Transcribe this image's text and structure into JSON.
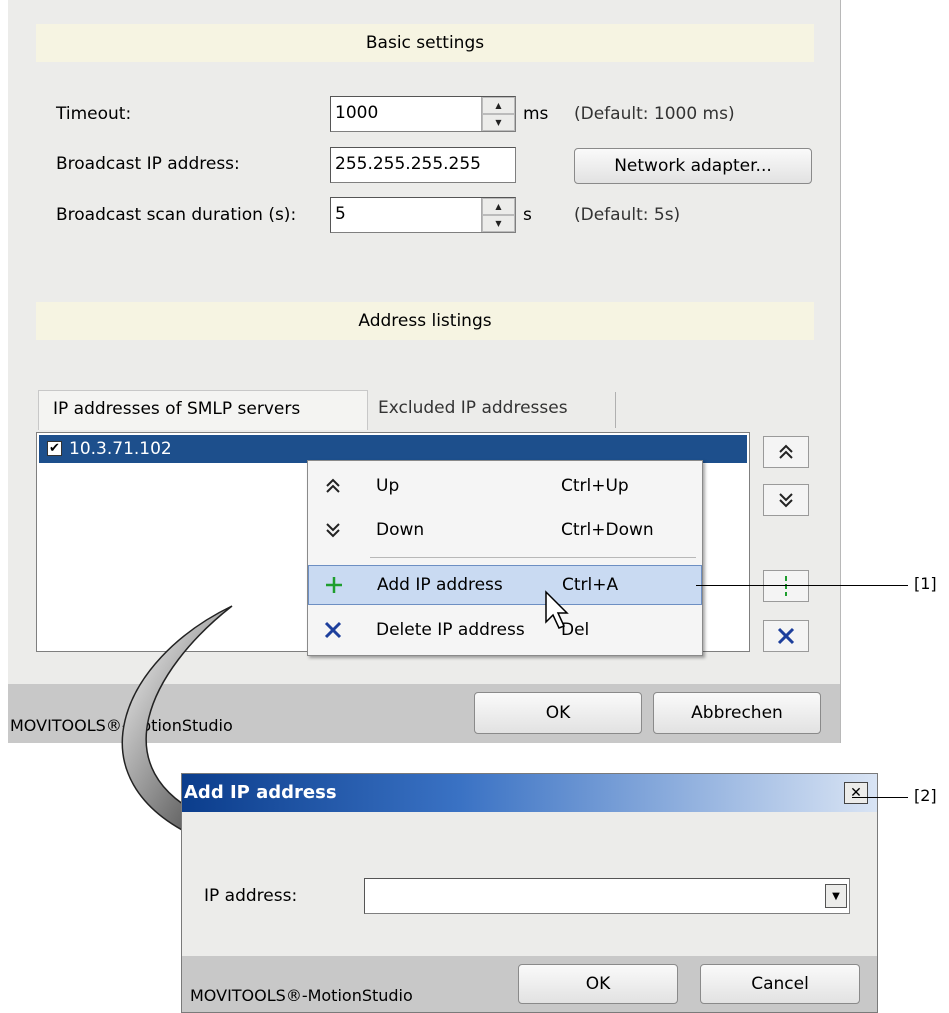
{
  "main": {
    "basic_settings_header": "Basic settings",
    "timeout_label": "Timeout:",
    "timeout_value": "1000",
    "timeout_unit": "ms",
    "timeout_default": "(Default: 1000 ms)",
    "broadcast_ip_label": "Broadcast IP address:",
    "broadcast_ip_value": "255.255.255.255",
    "network_adapter_button": "Network adapter...",
    "scan_duration_label": "Broadcast scan duration (s):",
    "scan_duration_value": "5",
    "scan_duration_unit": "s",
    "scan_duration_default": "(Default: 5s)",
    "address_listings_header": "Address listings",
    "tabs": [
      {
        "label": "IP addresses of SMLP servers",
        "active": true
      },
      {
        "label": "Excluded IP addresses",
        "active": false
      }
    ],
    "list_items": [
      {
        "label": "10.3.71.102",
        "checked": true,
        "selected": true
      }
    ],
    "ok_button": "OK",
    "cancel_button": "Abbrechen",
    "status_text": "MOVITOOLS®-MotionStudio"
  },
  "context_menu": {
    "items": [
      {
        "label": "Up",
        "shortcut": "Ctrl+Up",
        "icon": "double-chevron-up-icon"
      },
      {
        "label": "Down",
        "shortcut": "Ctrl+Down",
        "icon": "double-chevron-down-icon"
      },
      {
        "label": "Add IP address",
        "shortcut": "Ctrl+A",
        "icon": "plus-icon",
        "highlighted": true
      },
      {
        "label": "Delete IP address",
        "shortcut": "Del",
        "icon": "x-icon"
      }
    ]
  },
  "add_dialog": {
    "title": "Add IP address",
    "close_glyph": "✕",
    "ip_label": "IP address:",
    "ip_value": "",
    "ok_button": "OK",
    "cancel_button": "Cancel",
    "status_text": "MOVITOOLS®-MotionStudio"
  },
  "callouts": [
    "[1]",
    "[2]"
  ],
  "colors": {
    "selection": "#1d4f8c",
    "plus_green": "#1e9e2e",
    "x_blue": "#1d3f9c",
    "titlebar_start": "#0b3d8c",
    "section_header": "#f6f4e2"
  }
}
